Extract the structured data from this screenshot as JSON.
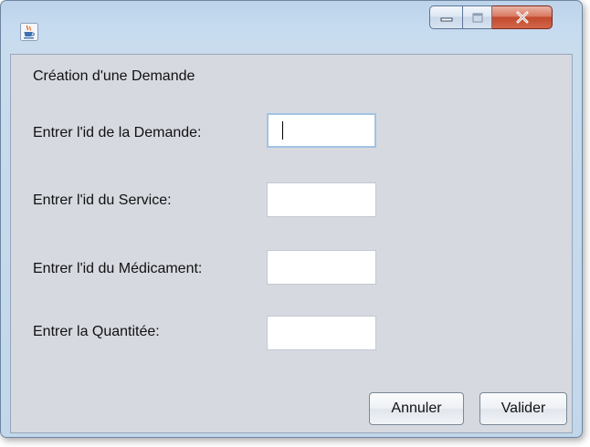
{
  "window": {
    "icon": "java-cup-icon",
    "controls": {
      "minimize_icon": "minimize-icon",
      "maximize_icon": "maximize-icon",
      "close_label": "X"
    }
  },
  "form": {
    "heading": "Création d'une Demande",
    "fields": [
      {
        "label": "Entrer l'id de la Demande:",
        "value": ""
      },
      {
        "label": "Entrer l'id du Service:",
        "value": ""
      },
      {
        "label": "Entrer l'id du Médicament:",
        "value": ""
      },
      {
        "label": "Entrer la Quantitée:",
        "value": ""
      }
    ],
    "cancel_label": "Annuler",
    "submit_label": "Valider"
  },
  "colors": {
    "panel_bg": "#d6d9e0",
    "titlebar": "#c6dbef",
    "close_button": "#c24a2e"
  }
}
